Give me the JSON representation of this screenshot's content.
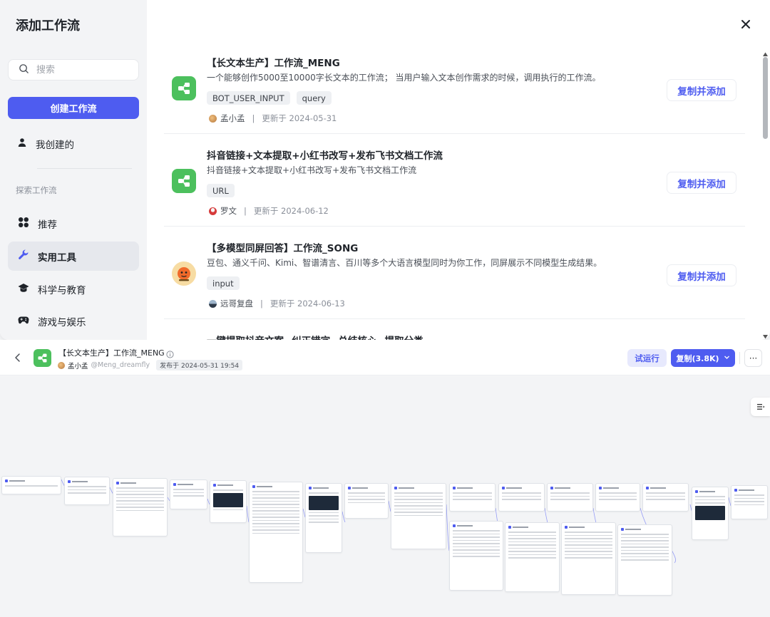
{
  "modal": {
    "title": "添加工作流",
    "search_placeholder": "搜索",
    "create_button": "创建工作流",
    "my_created": "我创建的",
    "explore_section": "探索工作流",
    "categories": [
      {
        "label": "推荐",
        "icon": "grid-icon"
      },
      {
        "label": "实用工具",
        "icon": "wrench-icon"
      },
      {
        "label": "科学与教育",
        "icon": "graduation-cap-icon"
      },
      {
        "label": "游戏与娱乐",
        "icon": "gamepad-icon"
      }
    ],
    "active_category": "实用工具",
    "workflows": [
      {
        "title": "【长文本生产】工作流_MENG",
        "description": "一个能够创作5000至10000字长文本的工作流； 当用户输入文本创作需求的时候，调用执行的工作流。",
        "tags": [
          "BOT_USER_INPUT",
          "query"
        ],
        "author": "孟小孟",
        "updated": "更新于 2024-05-31",
        "button": "复制并添加"
      },
      {
        "title": "抖音链接+文本提取+小红书改写+发布飞书文档工作流",
        "description": "抖音链接+文本提取+小红书改写+发布飞书文档工作流",
        "tags": [
          "URL"
        ],
        "author": "罗文",
        "updated": "更新于 2024-06-12",
        "button": "复制并添加"
      },
      {
        "title": "【多模型同屏回答】工作流_SONG",
        "description": "豆包、通义千问、Kimi、智谱清言、百川等多个大语言模型同时为你工作，同屏展示不同模型生成结果。",
        "tags": [
          "input"
        ],
        "author": "远哥复盘",
        "updated": "更新于 2024-06-13",
        "button": "复制并添加"
      },
      {
        "title": "一键提取抖音文案--纠正错字--总结核心--提取分类",
        "description": "",
        "tags": [],
        "author": "",
        "updated": "",
        "button": ""
      }
    ]
  },
  "workflow_view": {
    "title": "【长文本生产】工作流_MENG",
    "author": "孟小孟",
    "handle": "@Meng_dreamfly",
    "published": "发布于 2024-05-31 19:54",
    "test_run_button": "试运行",
    "duplicate_button": "复制(3.8K)",
    "more_button": "···"
  },
  "colors": {
    "accent": "#4e5cf0",
    "workflow_icon_green": "#4cc05d",
    "sidebar_bg": "#f3f4f6",
    "canvas_bg": "#f3f4f6"
  }
}
